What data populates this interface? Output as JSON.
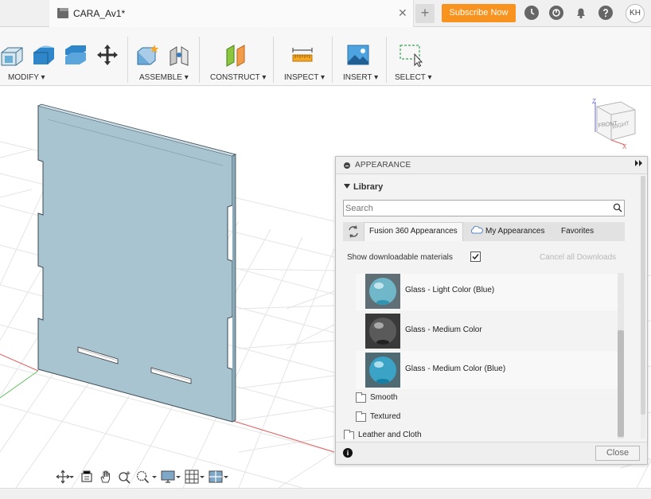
{
  "tabbar": {
    "doc_title": "CARA_Av1*",
    "close_glyph": "✕",
    "new_tab_glyph": "+",
    "subscribe_label": "Subscribe Now",
    "avatar_initials": "KH",
    "icons": [
      "box-document-icon",
      "clock-icon",
      "job-status-icon",
      "bell-icon",
      "help-icon"
    ]
  },
  "toolbar": {
    "groups": [
      {
        "label": "MODIFY ▾"
      },
      {
        "label": "ASSEMBLE ▾"
      },
      {
        "label": "CONSTRUCT ▾"
      },
      {
        "label": "INSPECT ▾"
      },
      {
        "label": "INSERT ▾"
      },
      {
        "label": "SELECT ▾"
      }
    ]
  },
  "viewcube": {
    "front": "FRONT",
    "right": "RIGHT",
    "axis_z": "Z",
    "axis_x": "X"
  },
  "appearance_panel": {
    "title": "APPEARANCE",
    "library_heading": "Library",
    "search_placeholder": "Search",
    "tabs": {
      "fusion": "Fusion 360 Appearances",
      "my": "My Appearances",
      "favorites": "Favorites"
    },
    "show_downloadable_label": "Show downloadable materials",
    "show_downloadable_checked": true,
    "cancel_downloads": "Cancel all Downloads",
    "materials": [
      {
        "name": "Glass - Light Color (Blue)",
        "tint": "#6fb7c9"
      },
      {
        "name": "Glass - Medium Color",
        "tint": "#5a5a5a"
      },
      {
        "name": "Glass - Medium Color (Blue)",
        "tint": "#3aa3c6"
      }
    ],
    "folders": [
      "Smooth",
      "Textured"
    ],
    "partial_folder": "Leather and Cloth",
    "close_label": "Close"
  },
  "colors": {
    "accent_orange": "#f7931e",
    "model_fill": "#a9c4d1",
    "axis_red": "#e06060",
    "axis_green": "#60c060"
  }
}
